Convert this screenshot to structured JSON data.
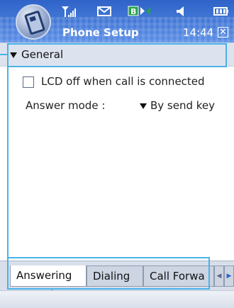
{
  "status_bar": {
    "title": "Phone Setup",
    "time": "14:44",
    "signal_icon": "signal-strength-icon",
    "message_icon": "envelope-icon",
    "connectivity_icon": "connectivity-icon",
    "volume_icon": "speaker-icon",
    "battery_icon": "battery-icon",
    "close_label": "✕"
  },
  "section": {
    "label": "General"
  },
  "options": {
    "lcd_off_label": "LCD off when call is connected",
    "lcd_off_checked": false,
    "answer_mode_label": "Answer mode :",
    "answer_mode_value": "By send key"
  },
  "tabs": [
    {
      "label": "Answering",
      "active": true
    },
    {
      "label": "Dialing",
      "active": false
    },
    {
      "label": "Call Forwa",
      "active": false
    }
  ],
  "tab_scroll": {
    "left_icon": "scroll-left-icon",
    "right_icon": "scroll-right-icon"
  },
  "colors": {
    "title_bar": "#3d72d6",
    "callout": "#49b2ea",
    "section_bg": "#dde3ee"
  }
}
